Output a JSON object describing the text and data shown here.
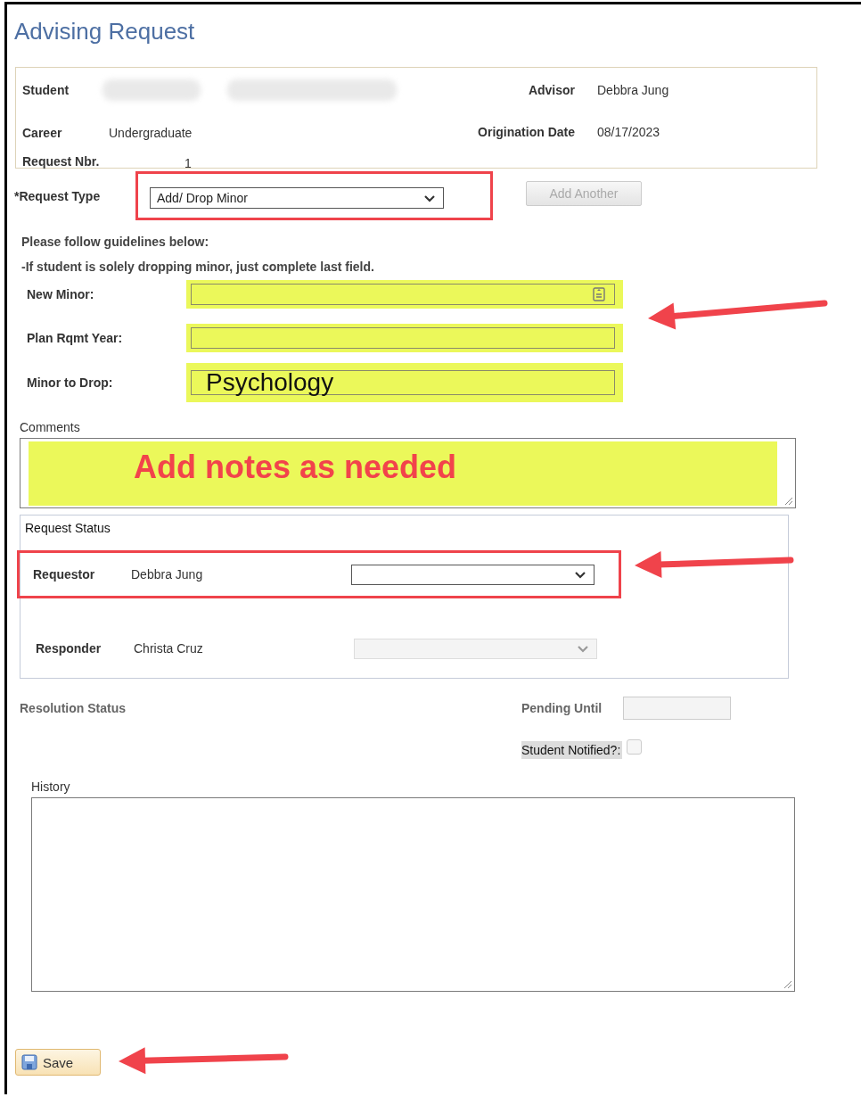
{
  "page_title": "Advising Request",
  "summary": {
    "student": {
      "label": "Student",
      "redacted": true
    },
    "career": {
      "label": "Career",
      "value": "Undergraduate"
    },
    "request_nbr": {
      "label": "Request Nbr.",
      "value": "1"
    },
    "advisor": {
      "label": "Advisor",
      "value": "Debbra Jung"
    },
    "origination_date": {
      "label": "Origination Date",
      "value": "08/17/2023"
    }
  },
  "request_type": {
    "label": "*Request Type",
    "value": "Add/ Drop Minor",
    "annotated": true
  },
  "add_another": {
    "label": "Add Another",
    "disabled": true
  },
  "guidelines": [
    "Please follow guidelines below:",
    "-If student is solely dropping minor, just complete last field."
  ],
  "fields": [
    {
      "kind": "lookup",
      "label": "New Minor:",
      "highlighted": true
    },
    {
      "kind": "text",
      "label": "Plan Rqmt Year:",
      "highlighted": true
    },
    {
      "kind": "text",
      "label": "Minor to Drop:",
      "value": "Psychology",
      "highlighted": true
    }
  ],
  "comments": {
    "label": "Comments",
    "value": "Add notes as needed",
    "highlighted": true
  },
  "request_status": {
    "title": "Request Status",
    "rows": [
      {
        "label": "Requestor",
        "name": "Debbra Jung",
        "disabled": false,
        "annotated": true
      },
      {
        "label": "Responder",
        "name": "Christa Cruz",
        "disabled": true,
        "annotated": false
      }
    ]
  },
  "resolution_status": {
    "label": "Resolution Status"
  },
  "pending_until": {
    "label": "Pending Until",
    "disabled": true
  },
  "student_notified": {
    "label": "Student Notified?:",
    "checked": false
  },
  "history": {
    "label": "History"
  },
  "save_button": {
    "label": "Save"
  }
}
